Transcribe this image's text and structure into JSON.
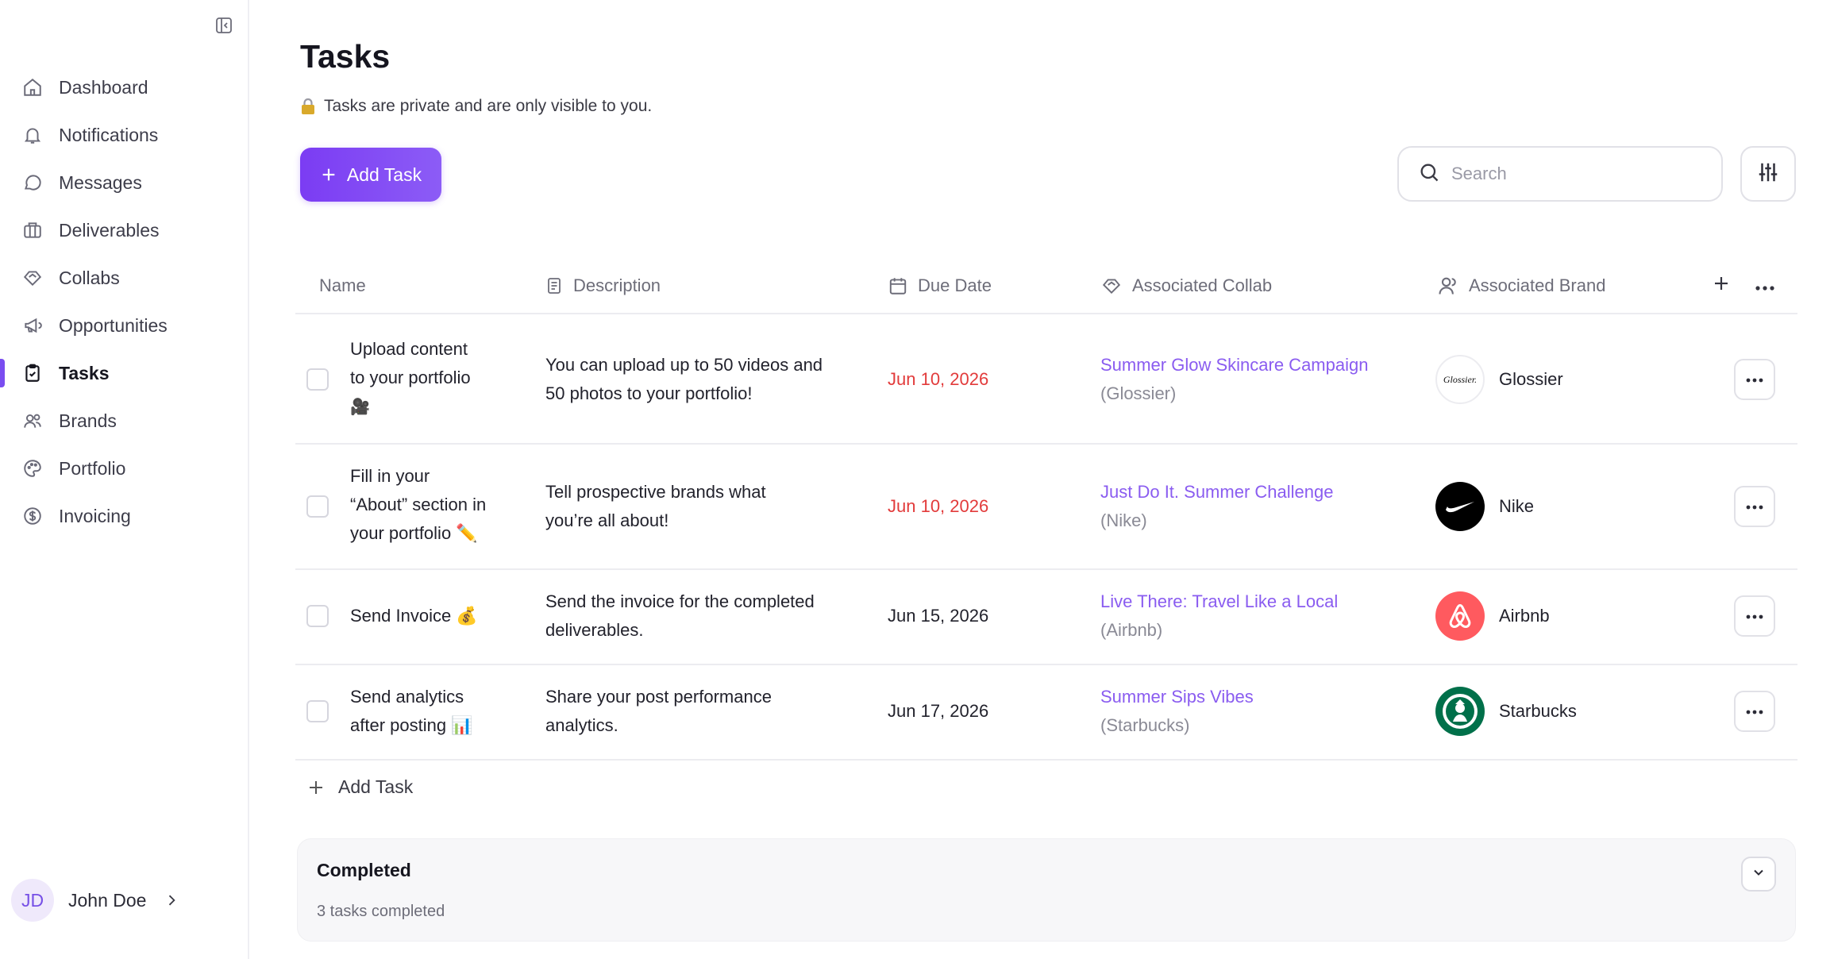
{
  "sidebar": {
    "items": [
      {
        "label": "Dashboard",
        "icon": "home-icon"
      },
      {
        "label": "Notifications",
        "icon": "bell-icon"
      },
      {
        "label": "Messages",
        "icon": "chat-icon"
      },
      {
        "label": "Deliverables",
        "icon": "briefcase-icon"
      },
      {
        "label": "Collabs",
        "icon": "handshake-icon"
      },
      {
        "label": "Opportunities",
        "icon": "megaphone-icon"
      },
      {
        "label": "Tasks",
        "icon": "clipboard-check-icon",
        "active": true
      },
      {
        "label": "Brands",
        "icon": "users-icon"
      },
      {
        "label": "Portfolio",
        "icon": "palette-icon"
      },
      {
        "label": "Invoicing",
        "icon": "dollar-circle-icon"
      }
    ],
    "user": {
      "initials": "JD",
      "name": "John Doe"
    }
  },
  "page": {
    "title": "Tasks",
    "privacy_note": "Tasks are private and are only visible to you.",
    "add_task_label": "Add Task",
    "search_placeholder": "Search"
  },
  "table": {
    "columns": {
      "name": "Name",
      "description": "Description",
      "due_date": "Due Date",
      "collab": "Associated Collab",
      "brand": "Associated Brand"
    },
    "rows": [
      {
        "name_lines": [
          "Upload content",
          "to your portfolio",
          "🎥"
        ],
        "desc_lines": [
          "You can upload up to 50 videos and",
          "50 photos to your portfolio!"
        ],
        "due": "Jun 10, 2026",
        "overdue": true,
        "collab": "Summer Glow Skincare Campaign",
        "collab_brand": "(Glossier)",
        "brand": "Glossier"
      },
      {
        "name_lines": [
          "Fill in your",
          "“About” section in",
          "your portfolio ✏️"
        ],
        "desc_lines": [
          "Tell prospective brands what",
          "you’re all about!"
        ],
        "due": "Jun 10, 2026",
        "overdue": true,
        "collab": "Just Do It. Summer Challenge",
        "collab_brand": "(Nike)",
        "brand": "Nike"
      },
      {
        "name_lines": [
          "Send Invoice 💰"
        ],
        "desc_lines": [
          "Send the invoice for the completed",
          "deliverables."
        ],
        "due": "Jun 15, 2026",
        "overdue": false,
        "collab": "Live There: Travel Like a Local",
        "collab_brand": "(Airbnb)",
        "brand": "Airbnb"
      },
      {
        "name_lines": [
          "Send analytics",
          "after posting 📊"
        ],
        "desc_lines": [
          "Share your post performance",
          "analytics."
        ],
        "due": "Jun 17, 2026",
        "overdue": false,
        "collab": "Summer Sips Vibes",
        "collab_brand": "(Starbucks)",
        "brand": "Starbucks"
      }
    ],
    "add_task_label": "Add Task"
  },
  "completed": {
    "title": "Completed",
    "subtitle": "3 tasks completed"
  },
  "colors": {
    "accent": "#7b3cf3",
    "overdue": "#e23b3b",
    "link": "#8a5cf0"
  }
}
